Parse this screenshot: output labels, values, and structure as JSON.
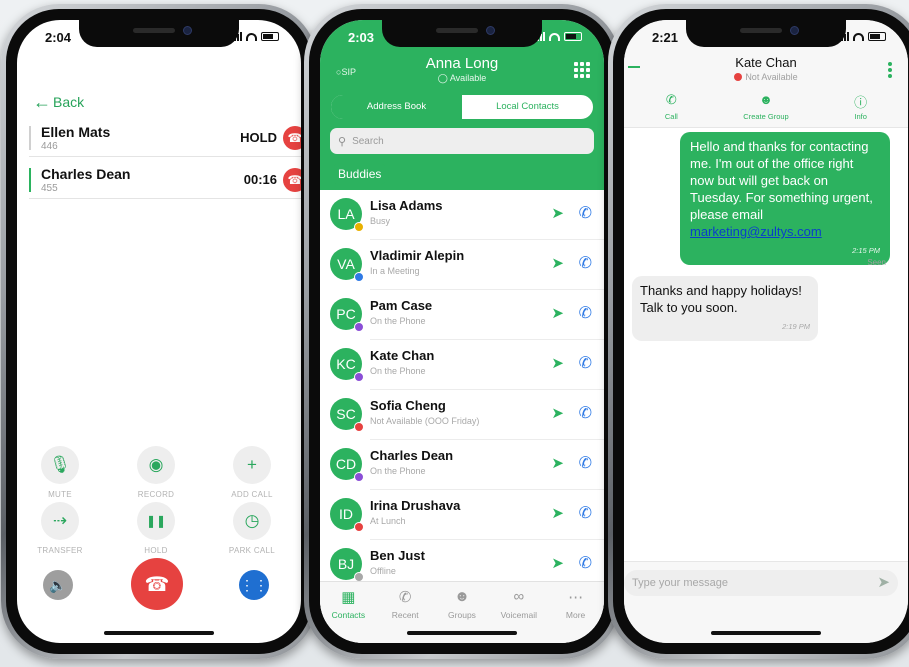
{
  "phone1": {
    "time": "2:04",
    "back_label": "Back",
    "calls": [
      {
        "name": "Ellen Mats",
        "ext": "446",
        "state": "HOLD"
      },
      {
        "name": "Charles Dean",
        "ext": "455",
        "state": "00:16"
      }
    ],
    "controls": [
      "MUTE",
      "RECORD",
      "ADD CALL",
      "TRANSFER",
      "HOLD",
      "PARK CALL"
    ]
  },
  "phone2": {
    "time": "2:03",
    "sip": "SIP",
    "user_name": "Anna Long",
    "user_status": "Available",
    "tabs": [
      "Address Book",
      "Local Contacts"
    ],
    "search_placeholder": "Search",
    "group_label": "Buddies",
    "contacts": [
      {
        "initials": "LA",
        "name": "Lisa Adams",
        "status": "Busy",
        "status_color": "#e8b100"
      },
      {
        "initials": "VA",
        "name": "Vladimir Alepin",
        "status": "In a Meeting",
        "status_color": "#2f7ae5"
      },
      {
        "initials": "PC",
        "name": "Pam Case",
        "status": "On the Phone",
        "status_color": "#8a4fd6"
      },
      {
        "initials": "KC",
        "name": "Kate Chan",
        "status": "On the Phone",
        "status_color": "#8a4fd6"
      },
      {
        "initials": "SC",
        "name": "Sofia Cheng",
        "status": "Not Available (OOO Friday)",
        "status_color": "#e64240"
      },
      {
        "initials": "CD",
        "name": "Charles Dean",
        "status": "On the Phone",
        "status_color": "#8a4fd6"
      },
      {
        "initials": "ID",
        "name": "Irina Drushava",
        "status": "At Lunch",
        "status_color": "#e64240"
      },
      {
        "initials": "BJ",
        "name": "Ben Just",
        "status": "Offline",
        "status_color": "#a8a8a8"
      }
    ],
    "tabbar": [
      "Contacts",
      "Recent",
      "Groups",
      "Voicemail",
      "More"
    ]
  },
  "phone3": {
    "time": "2:21",
    "contact_name": "Kate Chan",
    "contact_status": "Not Available",
    "actions": [
      "Call",
      "Create Group",
      "Info"
    ],
    "outgoing_text": "Hello and thanks for contacting me. I'm out of the office right now but will get back on Tuesday.  For something urgent, please email",
    "outgoing_link": "marketing@zultys.com",
    "outgoing_time": "2:15 PM",
    "seen_label": "Seen",
    "incoming_text": "Thanks and happy holidays! Talk to you soon.",
    "incoming_time": "2:19 PM",
    "composer_placeholder": "Type your message"
  },
  "colors": {
    "brand_green": "#2cb25f",
    "end_call_red": "#e64240",
    "call_icon_blue": "#2f7ae5",
    "keypad_blue": "#1f6fd1"
  }
}
